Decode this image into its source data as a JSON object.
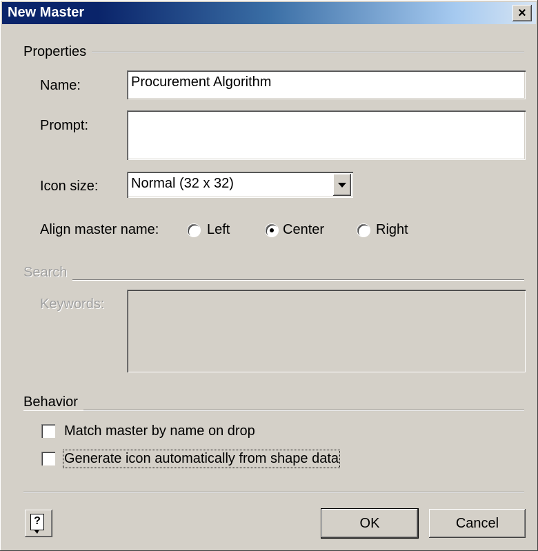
{
  "window": {
    "title": "New Master",
    "close_glyph": "×"
  },
  "properties": {
    "group_label": "Properties",
    "name_label": "Name:",
    "name_value": "Procurement Algorithm",
    "prompt_label": "Prompt:",
    "prompt_value": "",
    "icon_size_label": "Icon size:",
    "icon_size_value": "Normal (32 x 32)",
    "align_label": "Align master name:",
    "align_options": [
      {
        "label": "Left",
        "checked": false
      },
      {
        "label": "Center",
        "checked": true
      },
      {
        "label": "Right",
        "checked": false
      }
    ]
  },
  "search": {
    "group_label": "Search",
    "keywords_label": "Keywords:",
    "keywords_value": ""
  },
  "behavior": {
    "group_label": "Behavior",
    "match_label": "Match master by name on drop",
    "match_checked": false,
    "generate_label": "Generate icon automatically from shape data",
    "generate_checked": false
  },
  "footer": {
    "help_glyph": "?",
    "ok_label": "OK",
    "cancel_label": "Cancel"
  }
}
